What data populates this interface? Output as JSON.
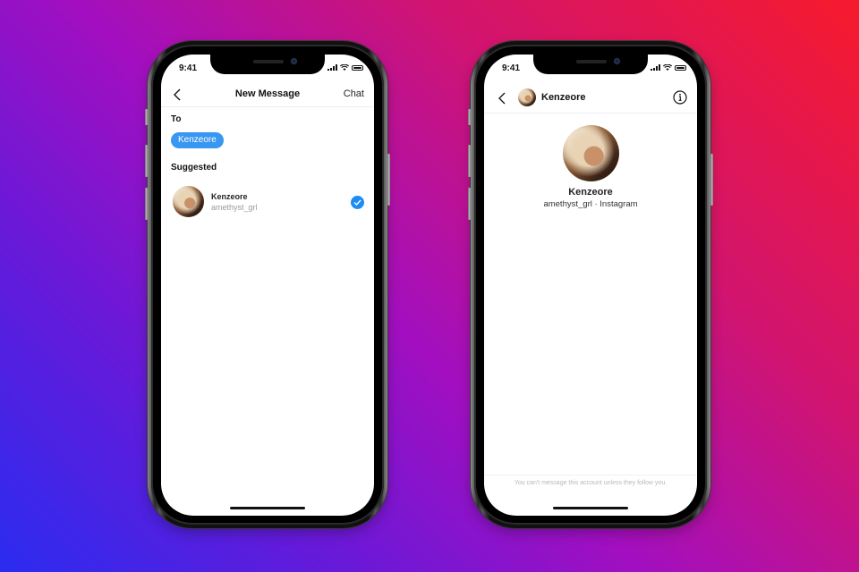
{
  "background": {
    "gradient_colors": [
      "#f71a2c",
      "#d11470",
      "#a20fc0",
      "#6a19d8",
      "#2a2cf0"
    ]
  },
  "phones": {
    "new_message": {
      "status_bar": {
        "time": "9:41",
        "icons": [
          "signal-icon",
          "wifi-icon",
          "battery-icon"
        ]
      },
      "nav": {
        "back_icon": "chevron-left-icon",
        "title": "New Message",
        "action_label": "Chat"
      },
      "to_label": "To",
      "recipient_chip": {
        "label": "Kenzeore",
        "color": "#3897f0"
      },
      "suggested_label": "Suggested",
      "suggested": [
        {
          "name": "Kenzeore",
          "username": "amethyst_grl",
          "selected": true,
          "check_color": "#1d8df5"
        }
      ]
    },
    "chat": {
      "status_bar": {
        "time": "9:41",
        "icons": [
          "signal-icon",
          "wifi-icon",
          "battery-icon"
        ]
      },
      "header": {
        "back_icon": "chevron-left-icon",
        "name": "Kenzeore",
        "info_icon": "info-icon"
      },
      "profile": {
        "name": "Kenzeore",
        "subtitle": "amethyst_grl · Instagram"
      },
      "footer_note": "You can't message this account unless they follow you."
    }
  }
}
